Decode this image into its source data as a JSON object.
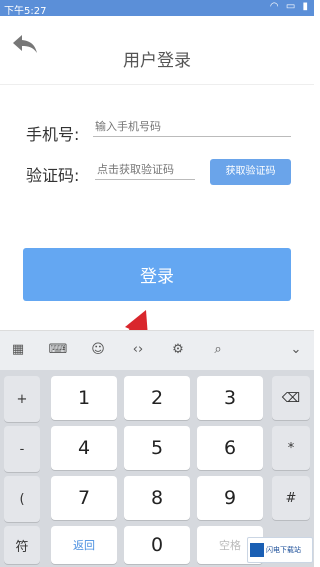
{
  "status_bar": {
    "time": "下午5:27",
    "icons": [
      "wifi-icon",
      "battery-low-icon",
      "signal-icon"
    ]
  },
  "header": {
    "title": "用户登录",
    "back_icon": "back-arrow-icon"
  },
  "form": {
    "phone_label": "手机号:",
    "phone_placeholder": "输入手机号码",
    "code_label": "验证码:",
    "code_placeholder": "点击获取验证码",
    "get_code_button": "获取验证码"
  },
  "login_button": "登录",
  "keyboard_toolbar": [
    "grid-icon",
    "keyboard-icon",
    "emoji-icon",
    "cursor-icon",
    "settings-icon",
    "search-icon",
    "chevron-down-icon"
  ],
  "keyboard": {
    "left_col": [
      "+",
      "-",
      "(",
      "符"
    ],
    "digits": [
      [
        "1",
        "2",
        "3"
      ],
      [
        "4",
        "5",
        "6"
      ],
      [
        "7",
        "8",
        "9"
      ]
    ],
    "right_col": [
      "*",
      "#"
    ],
    "bottom": {
      "return": "返回",
      "zero": "0",
      "space": "空格"
    }
  },
  "watermark": "闪电下载站",
  "colors": {
    "status_bar": "#5b8fd8",
    "button_blue": "#64a7f2",
    "code_button": "#6aa4ea",
    "arrow_red": "#d9262c"
  }
}
